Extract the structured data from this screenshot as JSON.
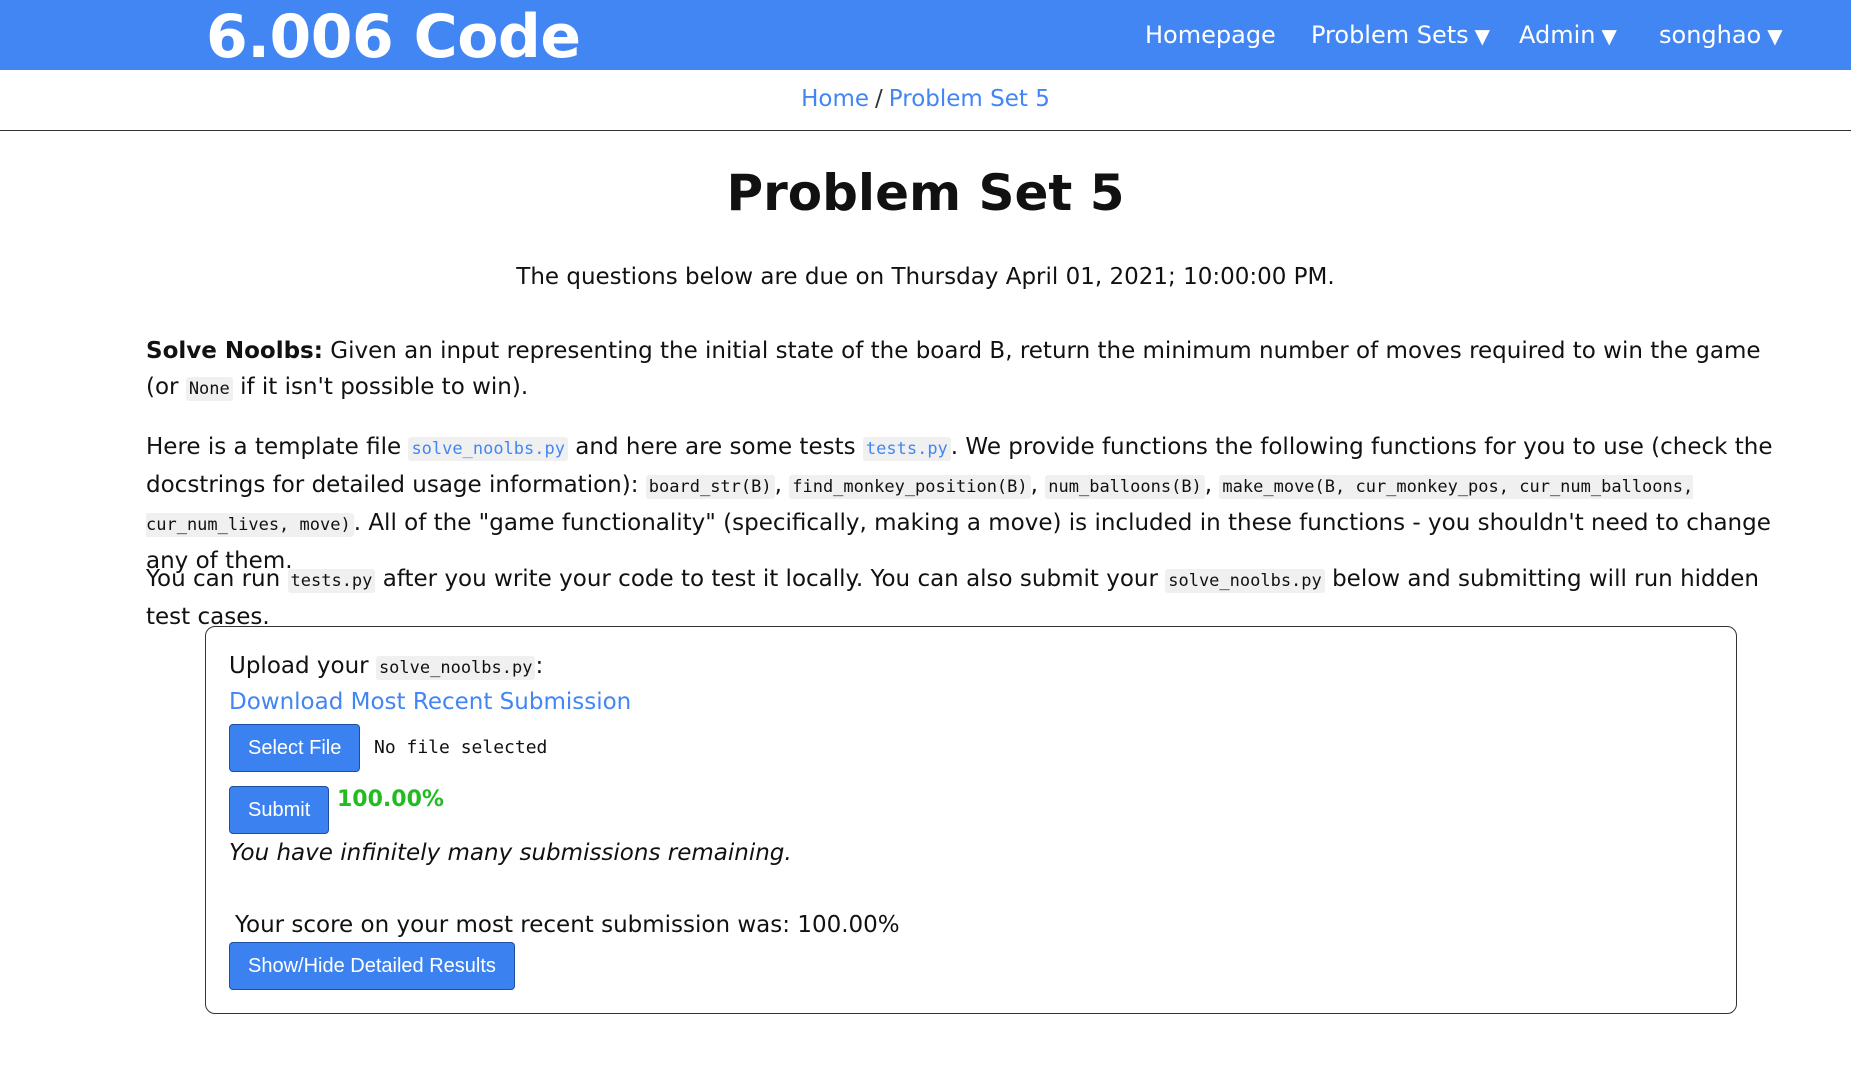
{
  "header": {
    "brand": "6.006 Code",
    "nav": [
      {
        "label": "Homepage",
        "caret": ""
      },
      {
        "label": "Problem Sets",
        "caret": "▼"
      },
      {
        "label": "Admin",
        "caret": "▼"
      },
      {
        "label": "songhao",
        "caret": "▼"
      }
    ]
  },
  "breadcrumb": {
    "home": "Home",
    "separator": "/",
    "current": "Problem Set 5"
  },
  "main": {
    "title": "Problem Set 5",
    "due": "The questions below are due on Thursday April 01, 2021; 10:00:00 PM.",
    "p1": {
      "bold": "Solve Noolbs:",
      "text_a": " Given an input representing the initial state of the board B, return the minimum number of moves required to win the game (or ",
      "code_none": "None",
      "text_b": " if it isn't possible to win)."
    },
    "p2": {
      "text_a": "Here is a template file ",
      "file_template": "solve_noolbs.py",
      "text_b": " and here are some tests ",
      "file_tests": "tests.py",
      "text_c": ". We provide functions the following functions for you to use (check the docstrings for detailed usage information): ",
      "fn1": "board_str(B)",
      "comma1": ", ",
      "fn2": "find_monkey_position(B)",
      "comma2": ", ",
      "fn3": "num_balloons(B)",
      "comma3": ", ",
      "fn4": "make_move(B, cur_monkey_pos, cur_num_balloons, cur_num_lives, move)",
      "text_d": ". All of the \"game functionality\" (specifically, making a move) is included in these functions - you shouldn't need to change any of them."
    },
    "p3": {
      "text_a": "You can run ",
      "code_tests": "tests.py",
      "text_b": " after you write your code to test it locally. You can also submit your ",
      "code_file": "solve_noolbs.py",
      "text_c": " below and submitting will run hidden test cases."
    }
  },
  "submission": {
    "upload_prefix": "Upload your ",
    "upload_file": "solve_noolbs.py",
    "upload_suffix": ":",
    "download_link": "Download Most Recent Submission",
    "select_button": "Select File",
    "file_status": "No file selected",
    "submit_button": "Submit",
    "score": "100.00%",
    "remaining": "You have infinitely many submissions remaining.",
    "recent_score": "Your score on your most recent submission was: 100.00%",
    "details_button": "Show/Hide Detailed Results"
  },
  "colors": {
    "brand_blue": "#4286f4",
    "score_green": "#22bb22"
  }
}
